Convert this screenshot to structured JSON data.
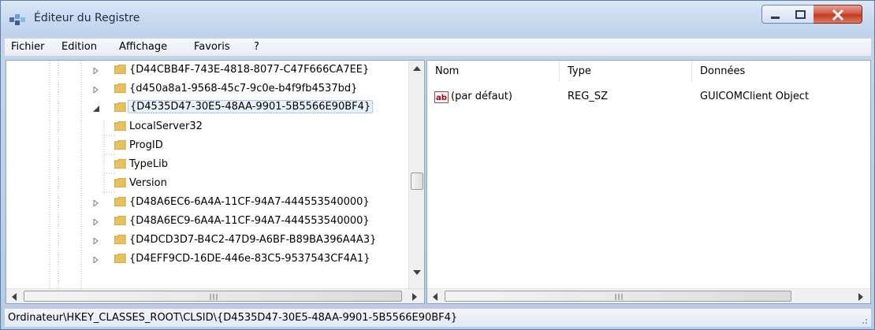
{
  "window": {
    "title": "Éditeur du Registre",
    "minimize_icon": "minimize-icon",
    "maximize_icon": "maximize-icon",
    "close_icon": "close-icon"
  },
  "menu": [
    "Fichier",
    "Edition",
    "Affichage",
    "Favoris",
    "?"
  ],
  "tree": {
    "items": [
      {
        "label": "{D44CBB4F-743E-4818-8077-C47F666CA7EE}",
        "level": 0,
        "expanded": false,
        "selected": false
      },
      {
        "label": "{d450a8a1-9568-45c7-9c0e-b4f9fb4537bd}",
        "level": 0,
        "expanded": false,
        "selected": false
      },
      {
        "label": "{D4535D47-30E5-48AA-9901-5B5566E90BF4}",
        "level": 0,
        "expanded": true,
        "selected": true
      },
      {
        "label": "LocalServer32",
        "level": 1,
        "expanded": false,
        "selected": false
      },
      {
        "label": "ProgID",
        "level": 1,
        "expanded": false,
        "selected": false
      },
      {
        "label": "TypeLib",
        "level": 1,
        "expanded": false,
        "selected": false
      },
      {
        "label": "Version",
        "level": 1,
        "expanded": false,
        "selected": false
      },
      {
        "label": "{D48A6EC6-6A4A-11CF-94A7-444553540000}",
        "level": 0,
        "expanded": false,
        "selected": false
      },
      {
        "label": "{D48A6EC9-6A4A-11CF-94A7-444553540000}",
        "level": 0,
        "expanded": false,
        "selected": false
      },
      {
        "label": "{D4DCD3D7-B4C2-47D9-A6BF-B89BA396A4A3}",
        "level": 0,
        "expanded": false,
        "selected": false
      },
      {
        "label": "{D4EFF9CD-16DE-446e-83C5-9537543CF4A1}",
        "level": 0,
        "expanded": false,
        "selected": false
      }
    ]
  },
  "values": {
    "columns": [
      "Nom",
      "Type",
      "Données"
    ],
    "rows": [
      {
        "name": "(par défaut)",
        "type": "REG_SZ",
        "data": "GUICOMClient Object",
        "icon": "string-value-icon"
      }
    ]
  },
  "status": {
    "path": "Ordinateur\\HKEY_CLASSES_ROOT\\CLSID\\{D4535D47-30E5-48AA-9901-5B5566E90BF4}"
  },
  "colors": {
    "folder": "#e8c15a",
    "selection_border": "#7da2ce",
    "titlebar": "#c9dbef"
  }
}
